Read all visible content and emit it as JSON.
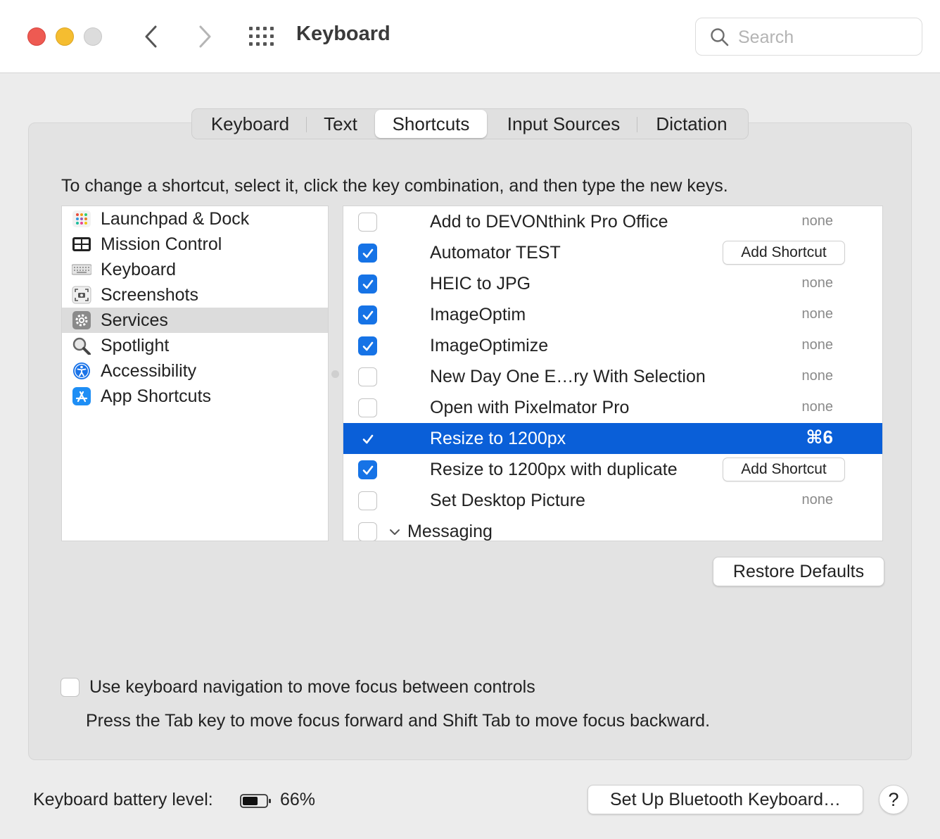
{
  "window": {
    "title": "Keyboard",
    "search_placeholder": "Search"
  },
  "tabs": [
    {
      "label": "Keyboard",
      "active": false
    },
    {
      "label": "Text",
      "active": false
    },
    {
      "label": "Shortcuts",
      "active": true
    },
    {
      "label": "Input Sources",
      "active": false
    },
    {
      "label": "Dictation",
      "active": false
    }
  ],
  "instructions": "To change a shortcut, select it, click the key combination, and then type the new keys.",
  "categories": [
    {
      "label": "Launchpad & Dock",
      "icon": "launchpad-icon",
      "selected": false
    },
    {
      "label": "Mission Control",
      "icon": "mission-control-icon",
      "selected": false
    },
    {
      "label": "Keyboard",
      "icon": "keyboard-icon",
      "selected": false
    },
    {
      "label": "Screenshots",
      "icon": "screenshot-icon",
      "selected": false
    },
    {
      "label": "Services",
      "icon": "gear-icon",
      "selected": true
    },
    {
      "label": "Spotlight",
      "icon": "magnifier-icon",
      "selected": false
    },
    {
      "label": "Accessibility",
      "icon": "accessibility-icon",
      "selected": false
    },
    {
      "label": "App Shortcuts",
      "icon": "app-store-icon",
      "selected": false
    }
  ],
  "shortcuts": [
    {
      "label": "Add to DEVONthink Pro Office",
      "checked": false,
      "value": "none"
    },
    {
      "label": "Automator TEST",
      "checked": true,
      "button": "Add Shortcut"
    },
    {
      "label": "HEIC to JPG",
      "checked": true,
      "value": "none"
    },
    {
      "label": "ImageOptim",
      "checked": true,
      "value": "none"
    },
    {
      "label": "ImageOptimize",
      "checked": true,
      "value": "none"
    },
    {
      "label": "New Day One E…ry With Selection",
      "checked": false,
      "value": "none"
    },
    {
      "label": "Open with Pixelmator Pro",
      "checked": false,
      "value": "none"
    },
    {
      "label": "Resize to 1200px",
      "checked": true,
      "value": "⌘6",
      "selected": true
    },
    {
      "label": "Resize to 1200px with duplicate",
      "checked": true,
      "button": "Add Shortcut"
    },
    {
      "label": "Set Desktop Picture",
      "checked": false,
      "value": "none"
    }
  ],
  "group_row": {
    "label": "Messaging",
    "checked": false
  },
  "restore_defaults": "Restore Defaults",
  "keyboard_navigation": {
    "label": "Use keyboard navigation to move focus between controls",
    "checked": false,
    "hint": "Press the Tab key to move focus forward and Shift Tab to move focus backward."
  },
  "battery": {
    "label": "Keyboard battery level:",
    "percent": "66%",
    "level": 0.66
  },
  "bluetooth_button": "Set Up Bluetooth Keyboard…",
  "help_button": "?",
  "colors": {
    "selection": "#0a5fd8",
    "checkbox": "#1673e6",
    "close": "#ee5a52",
    "minimize": "#f5bd30"
  }
}
